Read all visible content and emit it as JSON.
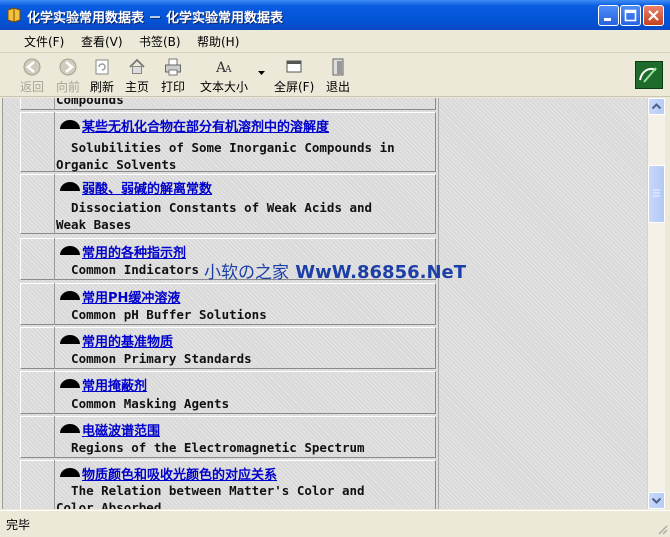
{
  "window": {
    "title": "化学实验常用数据表 － 化学实验常用数据表"
  },
  "menu": [
    "文件(F)",
    "查看(V)",
    "书签(B)",
    "帮助(H)"
  ],
  "toolbar": {
    "back": "返回",
    "forward": "向前",
    "refresh": "刷新",
    "home": "主页",
    "print": "打印",
    "textsize": "文本大小",
    "fullscreen": "全屏(F)",
    "exit": "退出"
  },
  "content": {
    "top_partial": "Compounds",
    "rows": [
      {
        "cn": "某些无机化合物在部分有机溶剂中的溶解度",
        "en1": "  Solubilities of Some Inorganic Compounds in",
        "en2": "Organic Solvents"
      },
      {
        "cn": "弱酸、弱碱的解离常数",
        "en1": "  Dissociation Constants of Weak Acids and",
        "en2": "Weak Bases"
      },
      {
        "cn": "常用的各种指示剂",
        "en1": "  Common Indicators"
      },
      {
        "cn": "常用PH缓冲溶液",
        "en1": "  Common pH Buffer Solutions"
      },
      {
        "cn": "常用的基准物质",
        "en1": "  Common Primary Standards"
      },
      {
        "cn": "常用掩蔽剂",
        "en1": "  Common Masking Agents"
      },
      {
        "cn": "电磁波谱范围",
        "en1": "  Regions of the Electromagnetic Spectrum"
      },
      {
        "cn": "物质颜色和吸收光颜色的对应关系",
        "en1": "  The Relation between Matter's Color and",
        "en2": "Color Absorbed"
      }
    ]
  },
  "watermark": {
    "prefix": "小软の之家",
    "site": "WwW.86856.NeT"
  },
  "status": {
    "text": "完毕"
  }
}
